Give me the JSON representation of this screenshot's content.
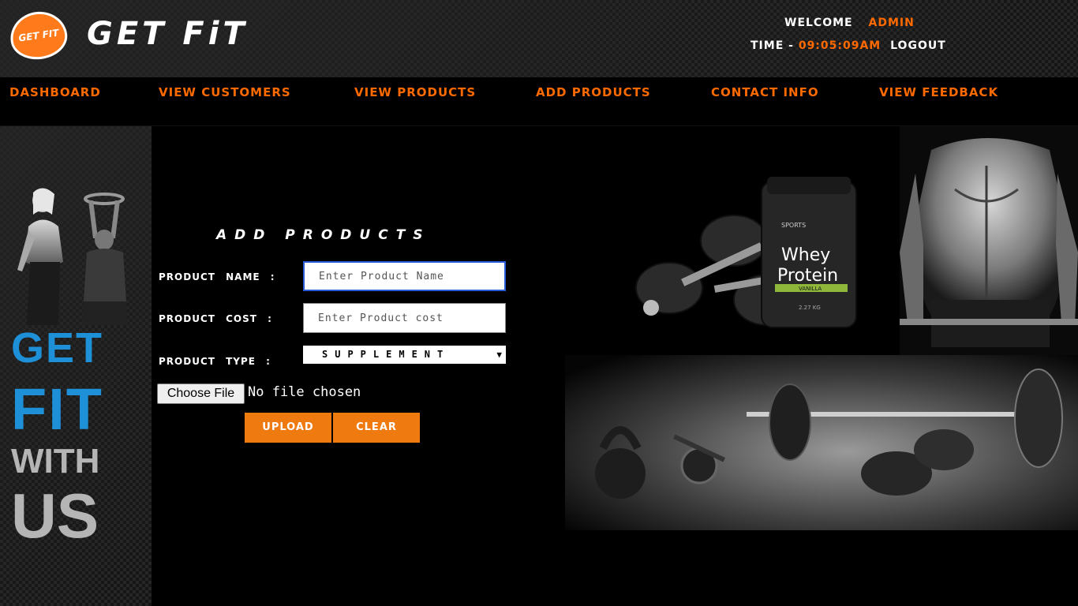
{
  "header": {
    "logo_text": "GET FIT",
    "brand": "GET FiT",
    "welcome_label": "WELCOME",
    "user": "ADMIN",
    "time_label": "TIME -",
    "time_value": "09:05:09AM",
    "logout": "LOGOUT"
  },
  "nav": {
    "items": [
      {
        "label": "DASHBOARD"
      },
      {
        "label": "VIEW CUSTOMERS"
      },
      {
        "label": "VIEW PRODUCTS"
      },
      {
        "label": "ADD PRODUCTS"
      },
      {
        "label": "CONTACT INFO"
      },
      {
        "label": "VIEW FEEDBACK"
      }
    ]
  },
  "side": {
    "line1": "GET",
    "line2": "FIT",
    "line3": "WITH",
    "line4": "US"
  },
  "form": {
    "title": "ADD PRODUCTS",
    "name_label": "PRODUCT NAME :",
    "name_placeholder": "Enter Product Name",
    "cost_label": "PRODUCT COST :",
    "cost_placeholder": "Enter Product cost",
    "type_label": "PRODUCT TYPE :",
    "type_value": "SUPPLEMENT",
    "file_button": "Choose File",
    "file_status": "No file chosen",
    "upload": "UPLOAD",
    "clear": "CLEAR"
  },
  "imagery": {
    "whey_brand": "SPORTS",
    "whey_title1": "Whey",
    "whey_title2": "Protein",
    "whey_flavor": "VANILLA",
    "whey_weight": "2.27 KG"
  },
  "colors": {
    "accent": "#ff6a00",
    "button": "#ee7a10",
    "slogan_blue": "#1e90d8",
    "slogan_gray": "#b5b5b5"
  }
}
